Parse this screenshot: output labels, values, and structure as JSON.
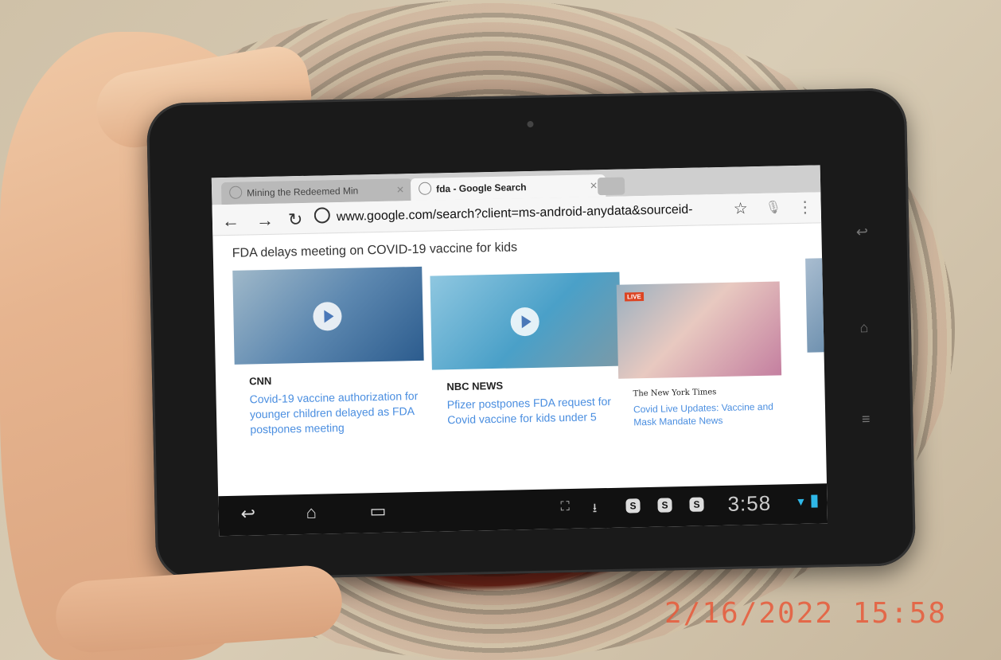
{
  "browser": {
    "tabs": [
      {
        "label": "Mining the Redeemed Min",
        "active": false
      },
      {
        "label": "fda - Google Search",
        "active": true
      }
    ],
    "url": "www.google.com/search?client=ms-android-anydata&sourceid-"
  },
  "page": {
    "headline": "FDA delays meeting on COVID-19 vaccine for kids",
    "cards": [
      {
        "source": "CNN",
        "title": "Covid-19 vaccine authorization for younger children delayed as FDA postpones meeting"
      },
      {
        "source": "NBC NEWS",
        "title": "Pfizer postpones FDA request for Covid vaccine for kids under 5"
      },
      {
        "source": "The New York Times",
        "badge": "LIVE",
        "title": "Covid Live Updates: Vaccine and Mask Mandate News"
      }
    ]
  },
  "statusbar": {
    "time": "3:58"
  },
  "photo": {
    "datestamp": "2/16/2022  15:58"
  }
}
